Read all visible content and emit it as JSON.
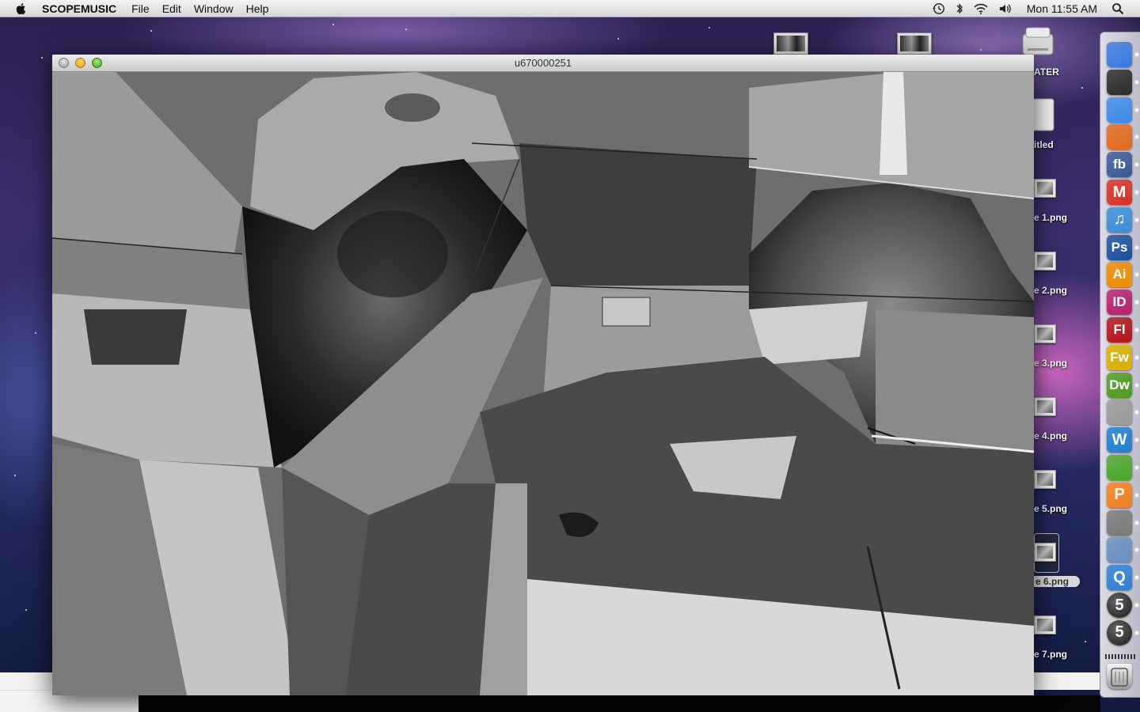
{
  "menubar": {
    "app_name": "SCOPEMUSIC",
    "menus": [
      "File",
      "Edit",
      "Window",
      "Help"
    ],
    "clock": "Mon 11:55 AM",
    "status_icons": [
      "time-machine-icon",
      "bluetooth-icon",
      "wifi-icon",
      "volume-icon",
      "spotlight-icon"
    ]
  },
  "window": {
    "title": "u670000251"
  },
  "desktop_icons": [
    {
      "label": "ATER",
      "kind": "drive"
    },
    {
      "label": "itled",
      "kind": "drive"
    },
    {
      "label": "e 1.png",
      "kind": "image"
    },
    {
      "label": "e 2.png",
      "kind": "image"
    },
    {
      "label": "e 3.png",
      "kind": "image"
    },
    {
      "label": "e 4.png",
      "kind": "image"
    },
    {
      "label": "e 5.png",
      "kind": "image"
    },
    {
      "label": "e 6.png",
      "kind": "image"
    },
    {
      "label": "e 7.png",
      "kind": "image"
    }
  ],
  "dock": {
    "items": [
      {
        "name": "finder",
        "glyph": "",
        "color": "#3a7be0"
      },
      {
        "name": "dashboard",
        "glyph": "",
        "color": "#2b2b2b"
      },
      {
        "name": "safari",
        "glyph": "",
        "color": "#3d8be8"
      },
      {
        "name": "firefox",
        "glyph": "",
        "color": "#e36a1c"
      },
      {
        "name": "facebook",
        "glyph": "fb",
        "color": "#3b5998"
      },
      {
        "name": "gmail",
        "glyph": "M",
        "color": "#d93025"
      },
      {
        "name": "itunes",
        "glyph": "♫",
        "color": "#3a8ed8"
      },
      {
        "name": "photoshop",
        "glyph": "Ps",
        "color": "#1c4f9c"
      },
      {
        "name": "illustrator",
        "glyph": "Ai",
        "color": "#f08c00"
      },
      {
        "name": "indesign",
        "glyph": "ID",
        "color": "#b8206e"
      },
      {
        "name": "flash",
        "glyph": "Fl",
        "color": "#b3141a"
      },
      {
        "name": "fireworks",
        "glyph": "Fw",
        "color": "#d8b000"
      },
      {
        "name": "dreamweaver",
        "glyph": "Dw",
        "color": "#4f9a21"
      },
      {
        "name": "dvd-player",
        "glyph": "",
        "color": "#9a9a9a"
      },
      {
        "name": "app-w",
        "glyph": "W",
        "color": "#1f7fd0"
      },
      {
        "name": "app-green",
        "glyph": "",
        "color": "#4aa82a"
      },
      {
        "name": "app-orange",
        "glyph": "P",
        "color": "#f0801e"
      },
      {
        "name": "system-preferences",
        "glyph": "",
        "color": "#7a7a7a"
      },
      {
        "name": "preview",
        "glyph": "",
        "color": "#6a8fc0"
      },
      {
        "name": "quicktime",
        "glyph": "Q",
        "color": "#2f7fd6"
      },
      {
        "name": "app-5a",
        "glyph": "5",
        "color": "#333333"
      },
      {
        "name": "app-5b",
        "glyph": "5",
        "color": "#333333"
      }
    ],
    "trash": "trash-icon"
  }
}
